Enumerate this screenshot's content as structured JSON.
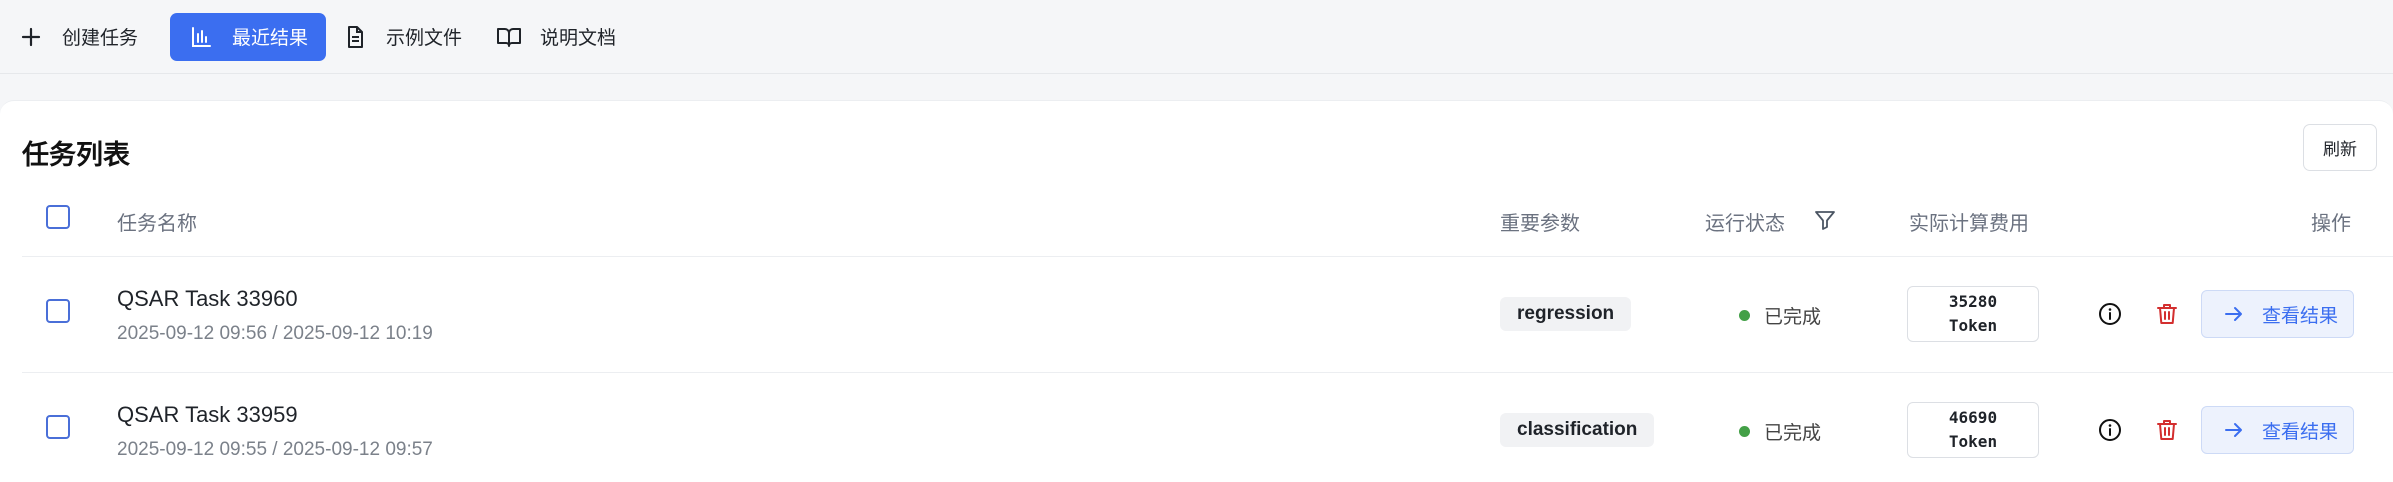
{
  "nav": {
    "items": [
      {
        "label": "创建任务",
        "icon": "plus-icon"
      },
      {
        "label": "最近结果",
        "icon": "bar-chart-icon",
        "active": true
      },
      {
        "label": "示例文件",
        "icon": "document-icon"
      },
      {
        "label": "说明文档",
        "icon": "book-icon"
      }
    ]
  },
  "card": {
    "title": "任务列表",
    "refresh_label": "刷新"
  },
  "table": {
    "headers": {
      "name": "任务名称",
      "params": "重要参数",
      "status": "运行状态",
      "cost": "实际计算费用",
      "actions": "操作"
    },
    "rows": [
      {
        "name": "QSAR Task 33960",
        "time": "2025-09-12 09:56 / 2025-09-12 10:19",
        "param": "regression",
        "status": "已完成",
        "cost_value": "35280",
        "cost_unit": "Token",
        "view_label": "查看结果"
      },
      {
        "name": "QSAR Task 33959",
        "time": "2025-09-12 09:55 / 2025-09-12 09:57",
        "param": "classification",
        "status": "已完成",
        "cost_value": "46690",
        "cost_unit": "Token",
        "view_label": "查看结果"
      }
    ]
  },
  "colors": {
    "accent": "#3b6ef0",
    "status_done": "#43a047",
    "delete": "#d32f2f"
  }
}
